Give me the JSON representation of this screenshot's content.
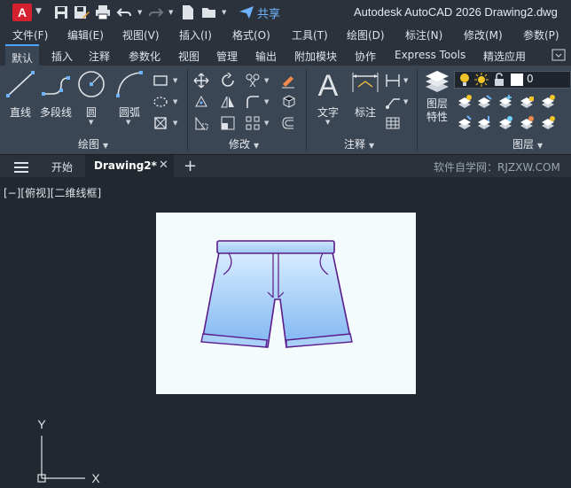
{
  "titlebar": {
    "app_letter": "A",
    "share_label": "共享",
    "title": "Autodesk AutoCAD 2026    Drawing2.dwg"
  },
  "menubar": {
    "items": [
      "文件(F)",
      "编辑(E)",
      "视图(V)",
      "插入(I)",
      "格式(O)",
      "工具(T)",
      "绘图(D)",
      "标注(N)",
      "修改(M)",
      "参数(P)"
    ]
  },
  "ribbon_tabs": {
    "items": [
      "默认",
      "插入",
      "注释",
      "参数化",
      "视图",
      "管理",
      "输出",
      "附加模块",
      "协作",
      "Express Tools",
      "精选应用"
    ],
    "active": "默认"
  },
  "ribbon": {
    "draw": {
      "line": "直线",
      "polyline": "多段线",
      "circle": "圆",
      "arc": "圆弧",
      "panel_title": "绘图"
    },
    "modify": {
      "panel_title": "修改"
    },
    "annotation": {
      "text": "文字",
      "dimension": "标注",
      "panel_title": "注释"
    },
    "layers": {
      "properties_line1": "图层",
      "properties_line2": "特性",
      "current_layer": "0",
      "panel_title": "图层"
    }
  },
  "filetabs": {
    "start": "开始",
    "active": "Drawing2*",
    "watermark": "软件自学网：RJZXW.COM"
  },
  "viewport": {
    "label": "[−][俯视][二维线框]",
    "ucs_x": "X",
    "ucs_y": "Y"
  },
  "colors": {
    "accent": "#4aa3ff",
    "autocad_red": "#d5202f",
    "shorts_outline": "#5a1a8c",
    "shorts_fill_top": "#d7ecff",
    "shorts_fill_bottom": "#7fb6f2"
  }
}
